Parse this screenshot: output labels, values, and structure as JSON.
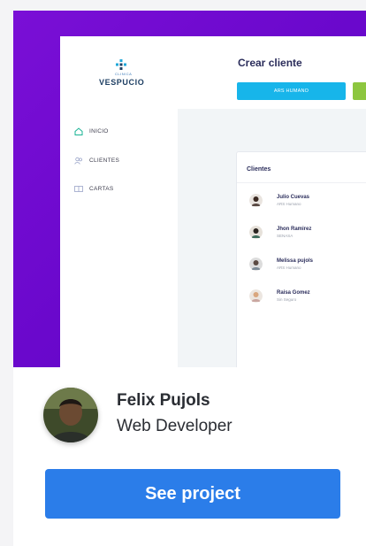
{
  "screenshot": {
    "brand_small": "CLINICA",
    "brand": "VESPUCIO",
    "nav": [
      {
        "label": "INICIO",
        "icon": "home-icon"
      },
      {
        "label": "CLIENTES",
        "icon": "users-icon"
      },
      {
        "label": "CARTAS",
        "icon": "cards-icon"
      }
    ],
    "page_title": "Crear cliente",
    "primary_pill": "ARS HUMANO",
    "panel_title": "Clientes",
    "clients": [
      {
        "name": "Julio Cuevas",
        "insurer": "ARS Humano"
      },
      {
        "name": "Jhon Ramirez",
        "insurer": "SENASA"
      },
      {
        "name": "Melissa pujols",
        "insurer": "ARS Humano"
      },
      {
        "name": "Raisa Gomez",
        "insurer": "Sin Seguro"
      }
    ],
    "colors": {
      "gradient": "#6a08cc",
      "accent_blue": "#17b5ea",
      "accent_green": "#8dc63f"
    }
  },
  "developer": {
    "name": "Felix Pujols",
    "role": "Web Developer"
  },
  "cta": {
    "label": "See project",
    "color": "#2b7de9"
  }
}
